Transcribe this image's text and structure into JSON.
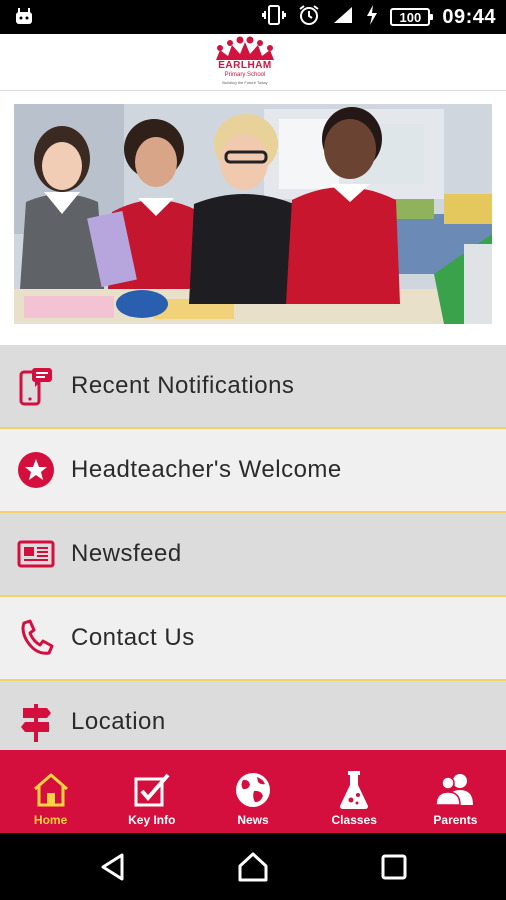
{
  "status_bar": {
    "time": "09:44",
    "battery": "100"
  },
  "header": {
    "logo_name": "EARLHAM",
    "logo_subtitle": "Primary School",
    "logo_tagline": "Building the Future Today"
  },
  "menu": {
    "items": [
      {
        "label": "Recent Notifications",
        "icon": "phone-notification-icon"
      },
      {
        "label": "Headteacher's Welcome",
        "icon": "star-badge-icon"
      },
      {
        "label": "Newsfeed",
        "icon": "newspaper-icon"
      },
      {
        "label": "Contact Us",
        "icon": "phone-icon"
      },
      {
        "label": "Location",
        "icon": "signpost-icon"
      }
    ]
  },
  "bottom_nav": {
    "items": [
      {
        "label": "Home",
        "icon": "home-icon",
        "active": true
      },
      {
        "label": "Key Info",
        "icon": "checkbox-icon",
        "active": false
      },
      {
        "label": "News",
        "icon": "globe-icon",
        "active": false
      },
      {
        "label": "Classes",
        "icon": "flask-icon",
        "active": false
      },
      {
        "label": "Parents",
        "icon": "parents-icon",
        "active": false
      }
    ]
  },
  "colors": {
    "brand_red": "#d40e3d",
    "active_yellow": "#ffd23f",
    "divider_yellow": "#f3d16b"
  }
}
